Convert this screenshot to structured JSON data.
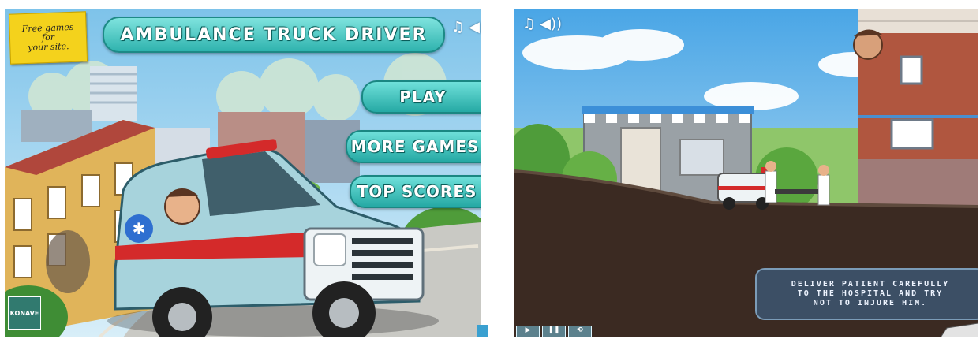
{
  "menu_screen": {
    "promo_lines": [
      "Free games",
      "for",
      "your site."
    ],
    "title": "AMBULANCE TRUCK DRIVER",
    "play_label": "PLAY",
    "more_games_label": "MORE GAMES",
    "top_scores_label": "TOP SCORES",
    "icons": [
      "music-note-icon",
      "speaker-icon"
    ],
    "music_glyph": "♫",
    "speaker_glyph": "◀)",
    "publisher_logo_text": "KONAVE"
  },
  "gameplay_screen": {
    "music_glyph": "♫",
    "speaker_glyph": "◀))",
    "instruction_text": "DELIVER PATIENT CAREFULLY\nTO THE HOSPITAL AND TRY\nNOT TO INJURE HIM.",
    "hud_buttons": [
      "▶",
      "❚❚",
      "⟲"
    ],
    "icons": [
      "music-note-icon",
      "speaker-icon",
      "pause-icon",
      "restart-icon"
    ]
  },
  "colors": {
    "accent_teal": "#2fb3ae",
    "sky": "#9fd3f0",
    "ground": "#3b2a22",
    "ambulance_red": "#d42a2a",
    "promo_yellow": "#f4d21c"
  }
}
